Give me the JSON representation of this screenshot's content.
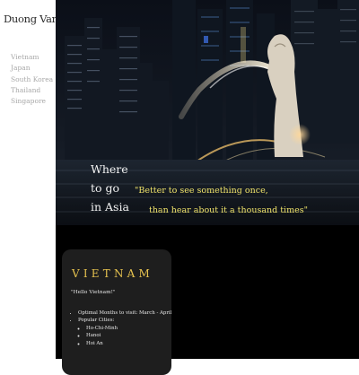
{
  "site": {
    "brand": "Duong Van Danien"
  },
  "nav": {
    "items": [
      "Vietnam",
      "Japan",
      "South Korea",
      "Thailand",
      "Singapore"
    ]
  },
  "hero": {
    "title_lines": [
      "Where",
      "to go",
      "in Asia"
    ],
    "quote_line1": "\"Better to see something once,",
    "quote_line2": "than hear about it a thousand times\""
  },
  "card": {
    "title": "VIETNAM",
    "greeting": "\"Hello Vietnam!\"",
    "facts": {
      "optimal_months": "Optimal Months to visit: March - April",
      "popular_cities_label": "Popular Cities:",
      "cities": [
        "Ho-Chi-Minh",
        "Hanoi",
        "Hoi An"
      ]
    }
  },
  "colors": {
    "accent_gold": "#e6c24f",
    "quote_yellow": "#f0e36a",
    "hero_dark": "#0a0d14"
  }
}
